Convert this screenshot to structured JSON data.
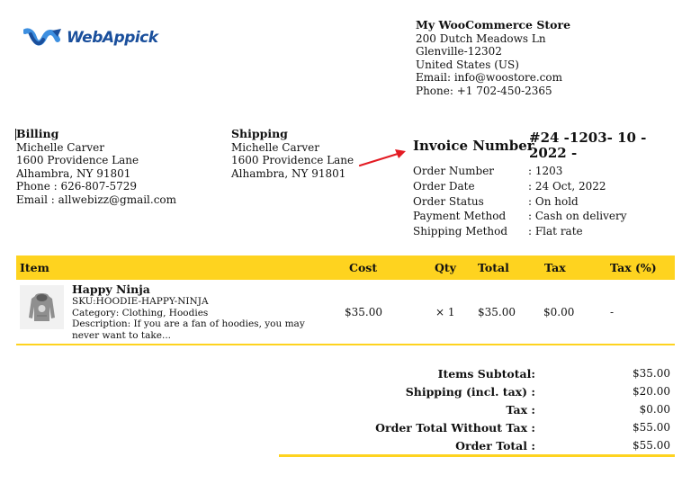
{
  "logo": {
    "text": "WebAppick"
  },
  "store": {
    "name": "My WooCommerce Store",
    "address1": "200 Dutch Meadows Ln",
    "city_zip": "Glenville-12302",
    "country": "United States (US)",
    "email": "Email: info@woostore.com",
    "phone": "Phone: +1 702-450-2365"
  },
  "billing": {
    "title": "Billing",
    "name": "Michelle Carver",
    "address1": "1600 Providence Lane",
    "city": "Alhambra, NY 91801",
    "phone": "Phone : 626-807-5729",
    "email": "Email : allwebizz@gmail.com"
  },
  "shipping": {
    "title": "Shipping",
    "name": "Michelle Carver",
    "address1": "1600 Providence Lane",
    "city": "Alhambra, NY 91801"
  },
  "invoice": {
    "label": "Invoice Number",
    "number": "#24 -1203- 10 - 2022 -"
  },
  "meta": [
    {
      "key": "Order Number",
      "value": ": 1203"
    },
    {
      "key": "Order Date",
      "value": ": 24 Oct, 2022"
    },
    {
      "key": "Order Status",
      "value": ": On hold"
    },
    {
      "key": "Payment Method",
      "value": ": Cash on delivery"
    },
    {
      "key": "Shipping Method",
      "value": ": Flat rate"
    }
  ],
  "table": {
    "headers": {
      "item": "Item",
      "cost": "Cost",
      "qty": "Qty",
      "total": "Total",
      "tax": "Tax",
      "tax_pct": "Tax (%)"
    },
    "rows": [
      {
        "name": "Happy Ninja",
        "sku": "SKU:HOODIE-HAPPY-NINJA",
        "category": "Category: Clothing, Hoodies",
        "description": "Description: If you are a fan of hoodies, you may never want to take...",
        "cost": "$35.00",
        "qty": "× 1",
        "total": "$35.00",
        "tax": "$0.00",
        "tax_pct": "-"
      }
    ]
  },
  "totals": [
    {
      "label": "Items Subtotal:",
      "value": "$35.00"
    },
    {
      "label": "Shipping (incl. tax) :",
      "value": "$20.00"
    },
    {
      "label": "Tax :",
      "value": "$0.00"
    },
    {
      "label": "Order Total Without Tax :",
      "value": "$55.00"
    },
    {
      "label": "Order Total :",
      "value": "$55.00"
    }
  ],
  "colors": {
    "accent": "#fed31f",
    "logo_blue": "#1a4f9c",
    "arrow": "#e31b23"
  }
}
